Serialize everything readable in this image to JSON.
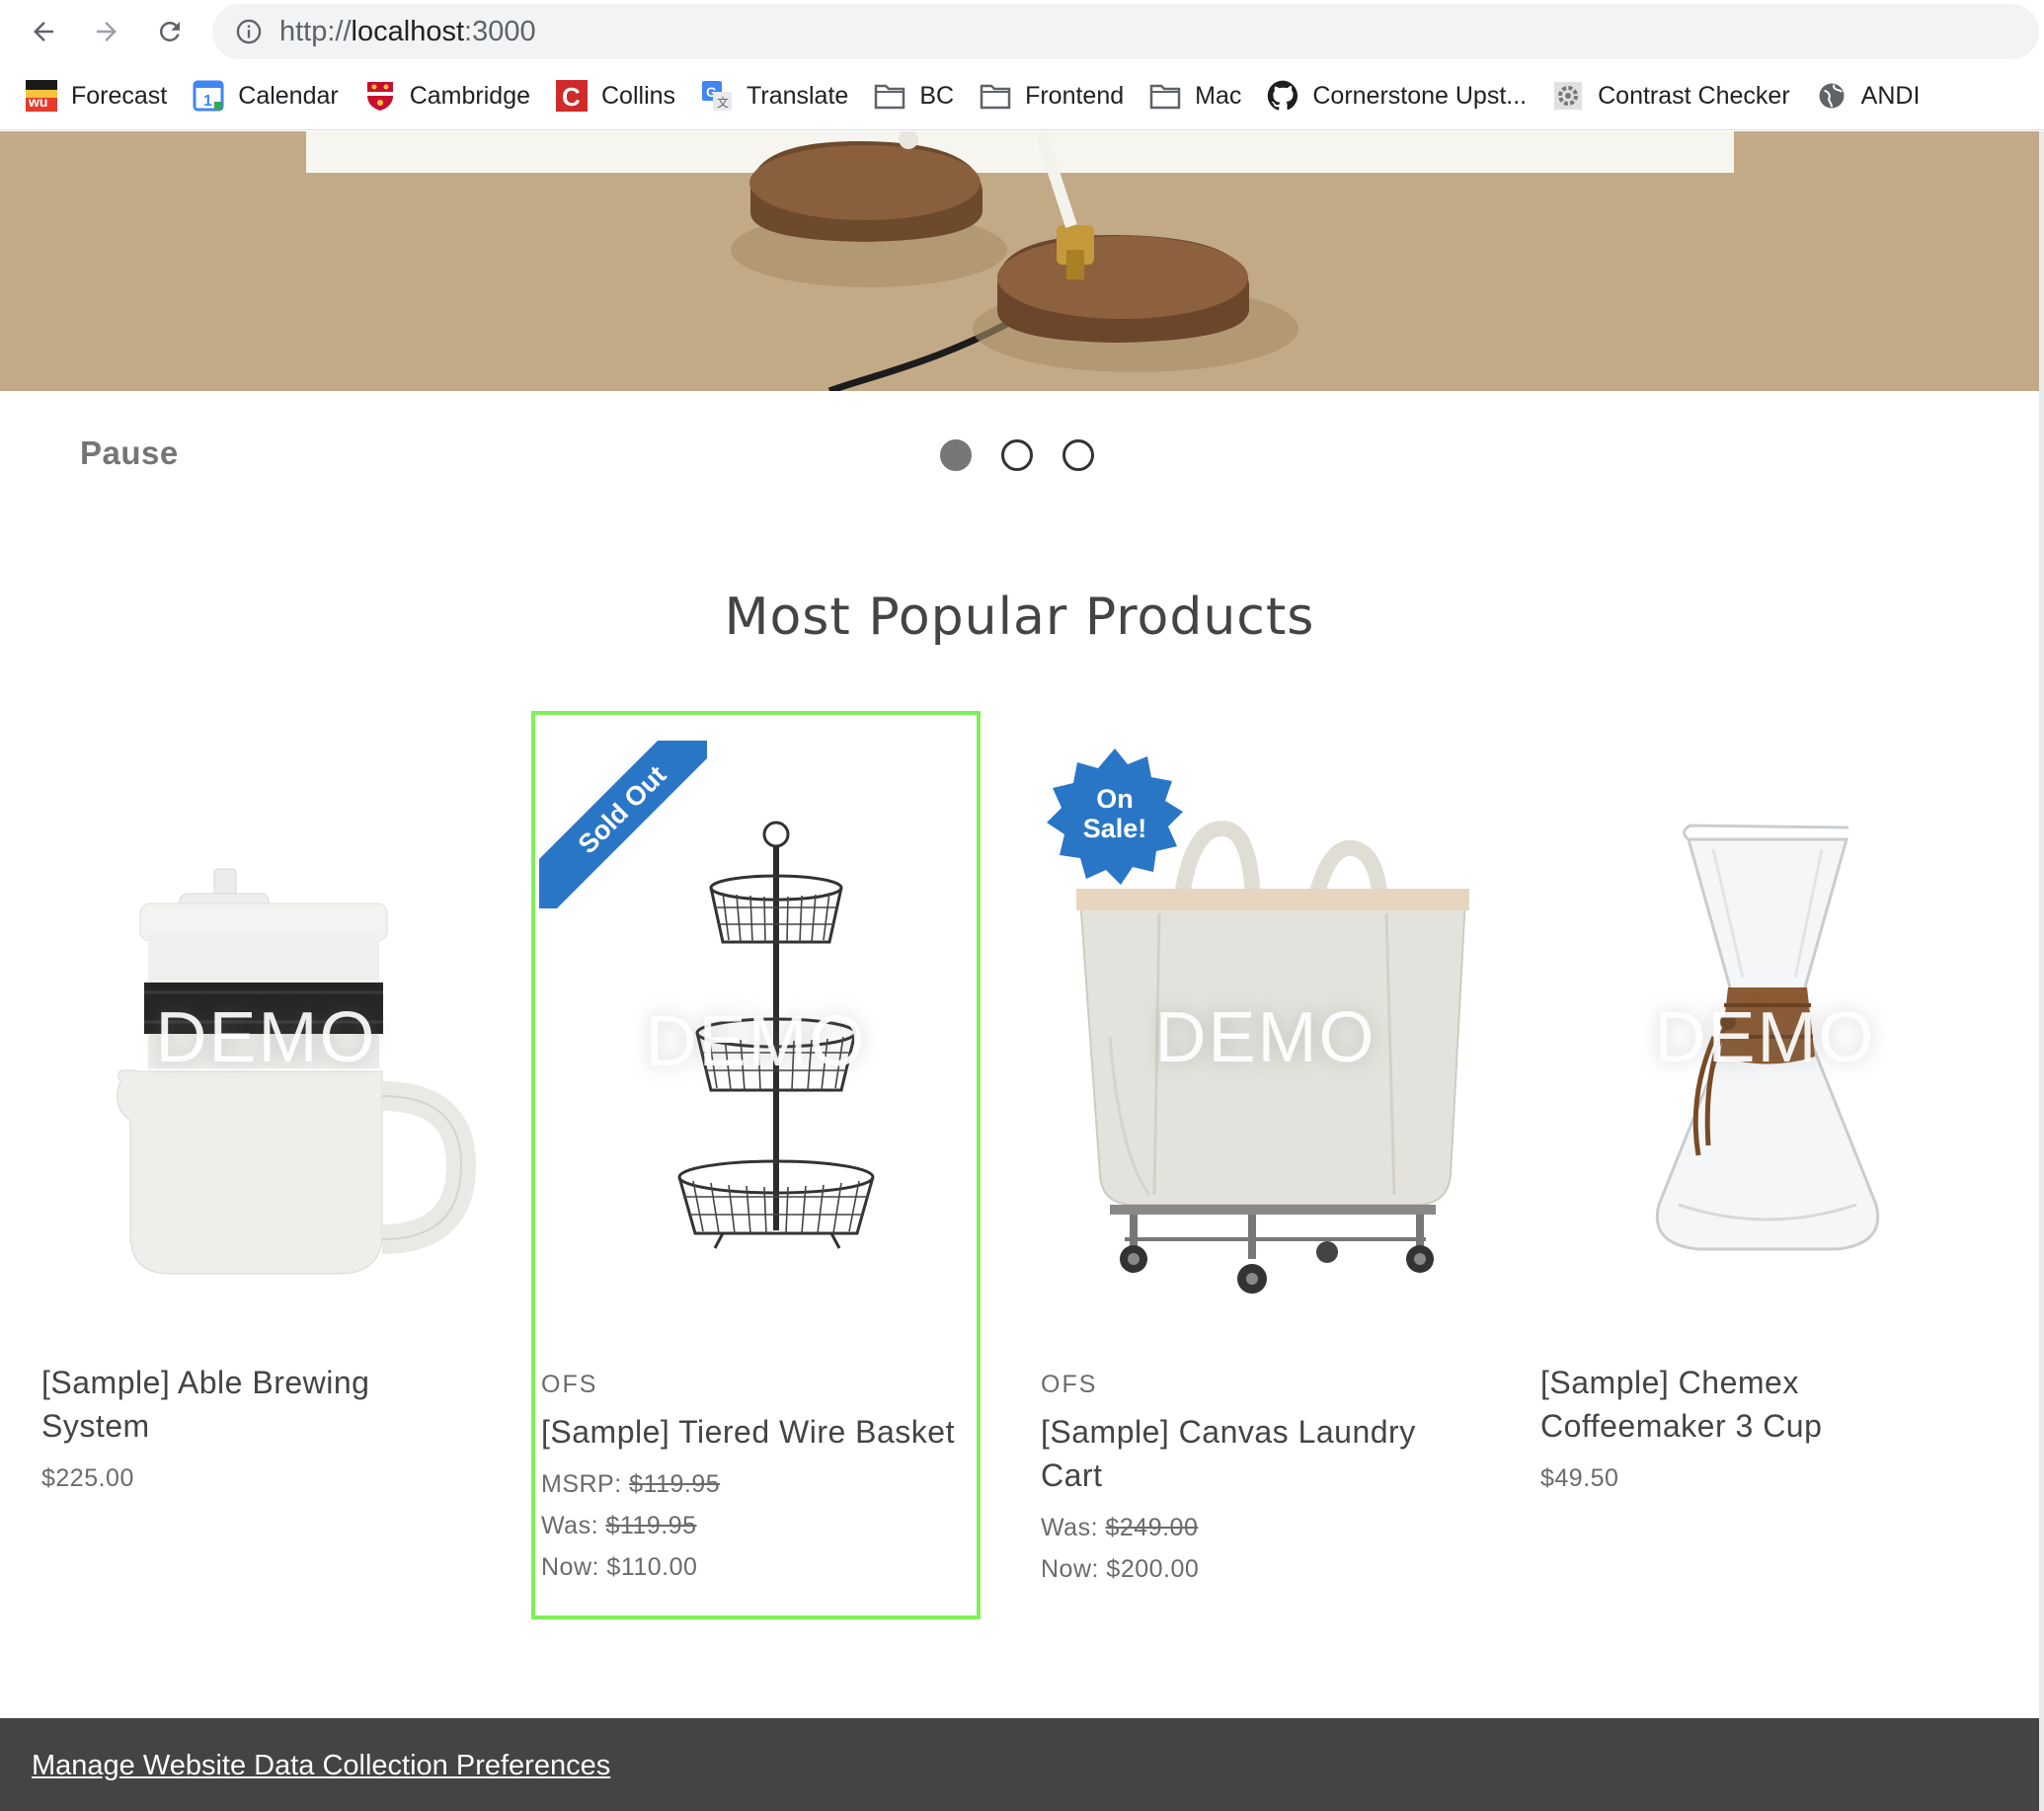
{
  "browser": {
    "url_scheme": "http://",
    "url_host": "localhost",
    "url_port": ":3000",
    "bookmarks": [
      {
        "label": "Forecast",
        "icon": "wunderground-icon"
      },
      {
        "label": "Calendar",
        "icon": "calendar-icon"
      },
      {
        "label": "Cambridge",
        "icon": "cambridge-crest-icon"
      },
      {
        "label": "Collins",
        "icon": "collins-icon"
      },
      {
        "label": "Translate",
        "icon": "translate-icon"
      },
      {
        "label": "BC",
        "icon": "folder-icon"
      },
      {
        "label": "Frontend",
        "icon": "folder-icon"
      },
      {
        "label": "Mac",
        "icon": "folder-icon"
      },
      {
        "label": "Cornerstone Upst...",
        "icon": "github-icon"
      },
      {
        "label": "Contrast Checker",
        "icon": "gear-icon"
      },
      {
        "label": "ANDI",
        "icon": "globe-icon"
      }
    ]
  },
  "carousel": {
    "pause_label": "Pause",
    "slides": 3,
    "active_slide": 1
  },
  "section": {
    "title": "Most Popular Products"
  },
  "products": [
    {
      "brand": "",
      "title_line1": "[Sample] Able Brewing",
      "title_line2": "System",
      "price": "$225.00",
      "watermark": "DEMO"
    },
    {
      "badge": "Sold Out",
      "brand": "OFS",
      "title_line1": "[Sample] Tiered Wire Basket",
      "msrp_label": "MSRP:",
      "msrp": "$119.95",
      "was_label": "Was:",
      "was": "$119.95",
      "now_label": "Now:",
      "now": "$110.00",
      "watermark": "DEMO"
    },
    {
      "badge_line1": "On",
      "badge_line2": "Sale!",
      "brand": "OFS",
      "title_line1": "[Sample] Canvas Laundry",
      "title_line2": "Cart",
      "was_label": "Was:",
      "was": "$249.00",
      "now_label": "Now:",
      "now": "$200.00",
      "watermark": "DEMO"
    },
    {
      "brand": "",
      "title_line1": "[Sample] Chemex",
      "title_line2": "Coffeemaker 3 Cup",
      "price": "$49.50",
      "watermark": "DEMO"
    }
  ],
  "footer": {
    "link": "Manage Website Data Collection Preferences"
  },
  "colors": {
    "hero_bg": "#c3aa87",
    "badge_blue": "#2a76c6",
    "focus_outline": "#7ef05a",
    "footer_bg": "#444444"
  }
}
